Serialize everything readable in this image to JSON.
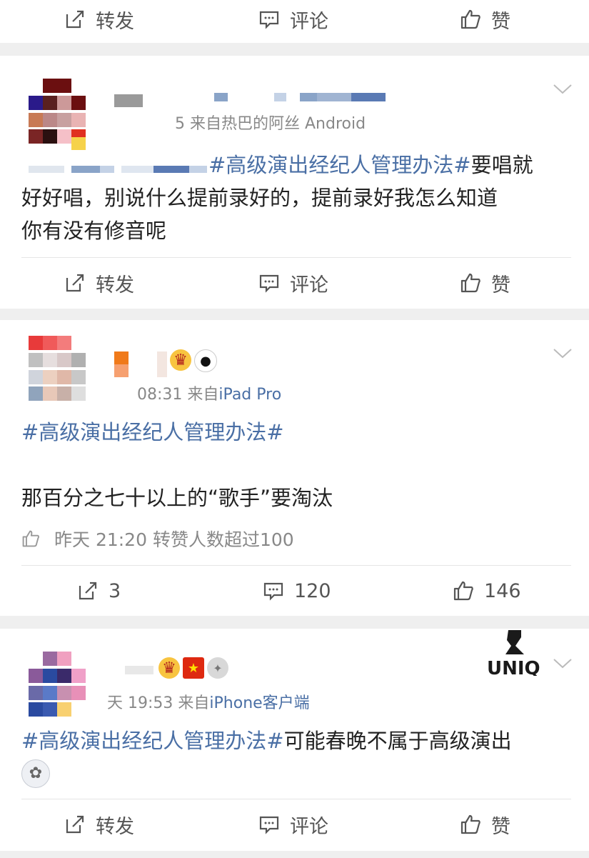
{
  "top_actions": {
    "repost": "转发",
    "comment": "评论",
    "like": "赞"
  },
  "posts": [
    {
      "time": "5",
      "source_prefix": "来自",
      "source": "热巴的阿丝 Android",
      "topic": "#高级演出经纪人管理办法#",
      "text_1": "要唱就",
      "text_2": "好好唱，别说什么提前录好的，提前录好我怎么知道",
      "text_3": "你有没有修音呢",
      "actions": {
        "repost": "转发",
        "comment": "评论",
        "like": "赞"
      }
    },
    {
      "time": "08:31",
      "source_prefix": "来自",
      "source": "iPad Pro",
      "topic": "#高级演出经纪人管理办法#",
      "text": "那百分之七十以上的“歌手”要淘汰",
      "like_line": "昨天 21:20 转赞人数超过100",
      "actions": {
        "repost": "3",
        "comment": "120",
        "like": "146"
      }
    },
    {
      "time": "天 19:53",
      "source_prefix": "来自",
      "source": "iPhone客户端",
      "topic": "#高级演出经纪人管理办法#",
      "text": "可能春晚不属于高级演出",
      "watermark": "UNIQ",
      "actions": {
        "repost": "转发",
        "comment": "评论",
        "like": "赞"
      }
    }
  ]
}
